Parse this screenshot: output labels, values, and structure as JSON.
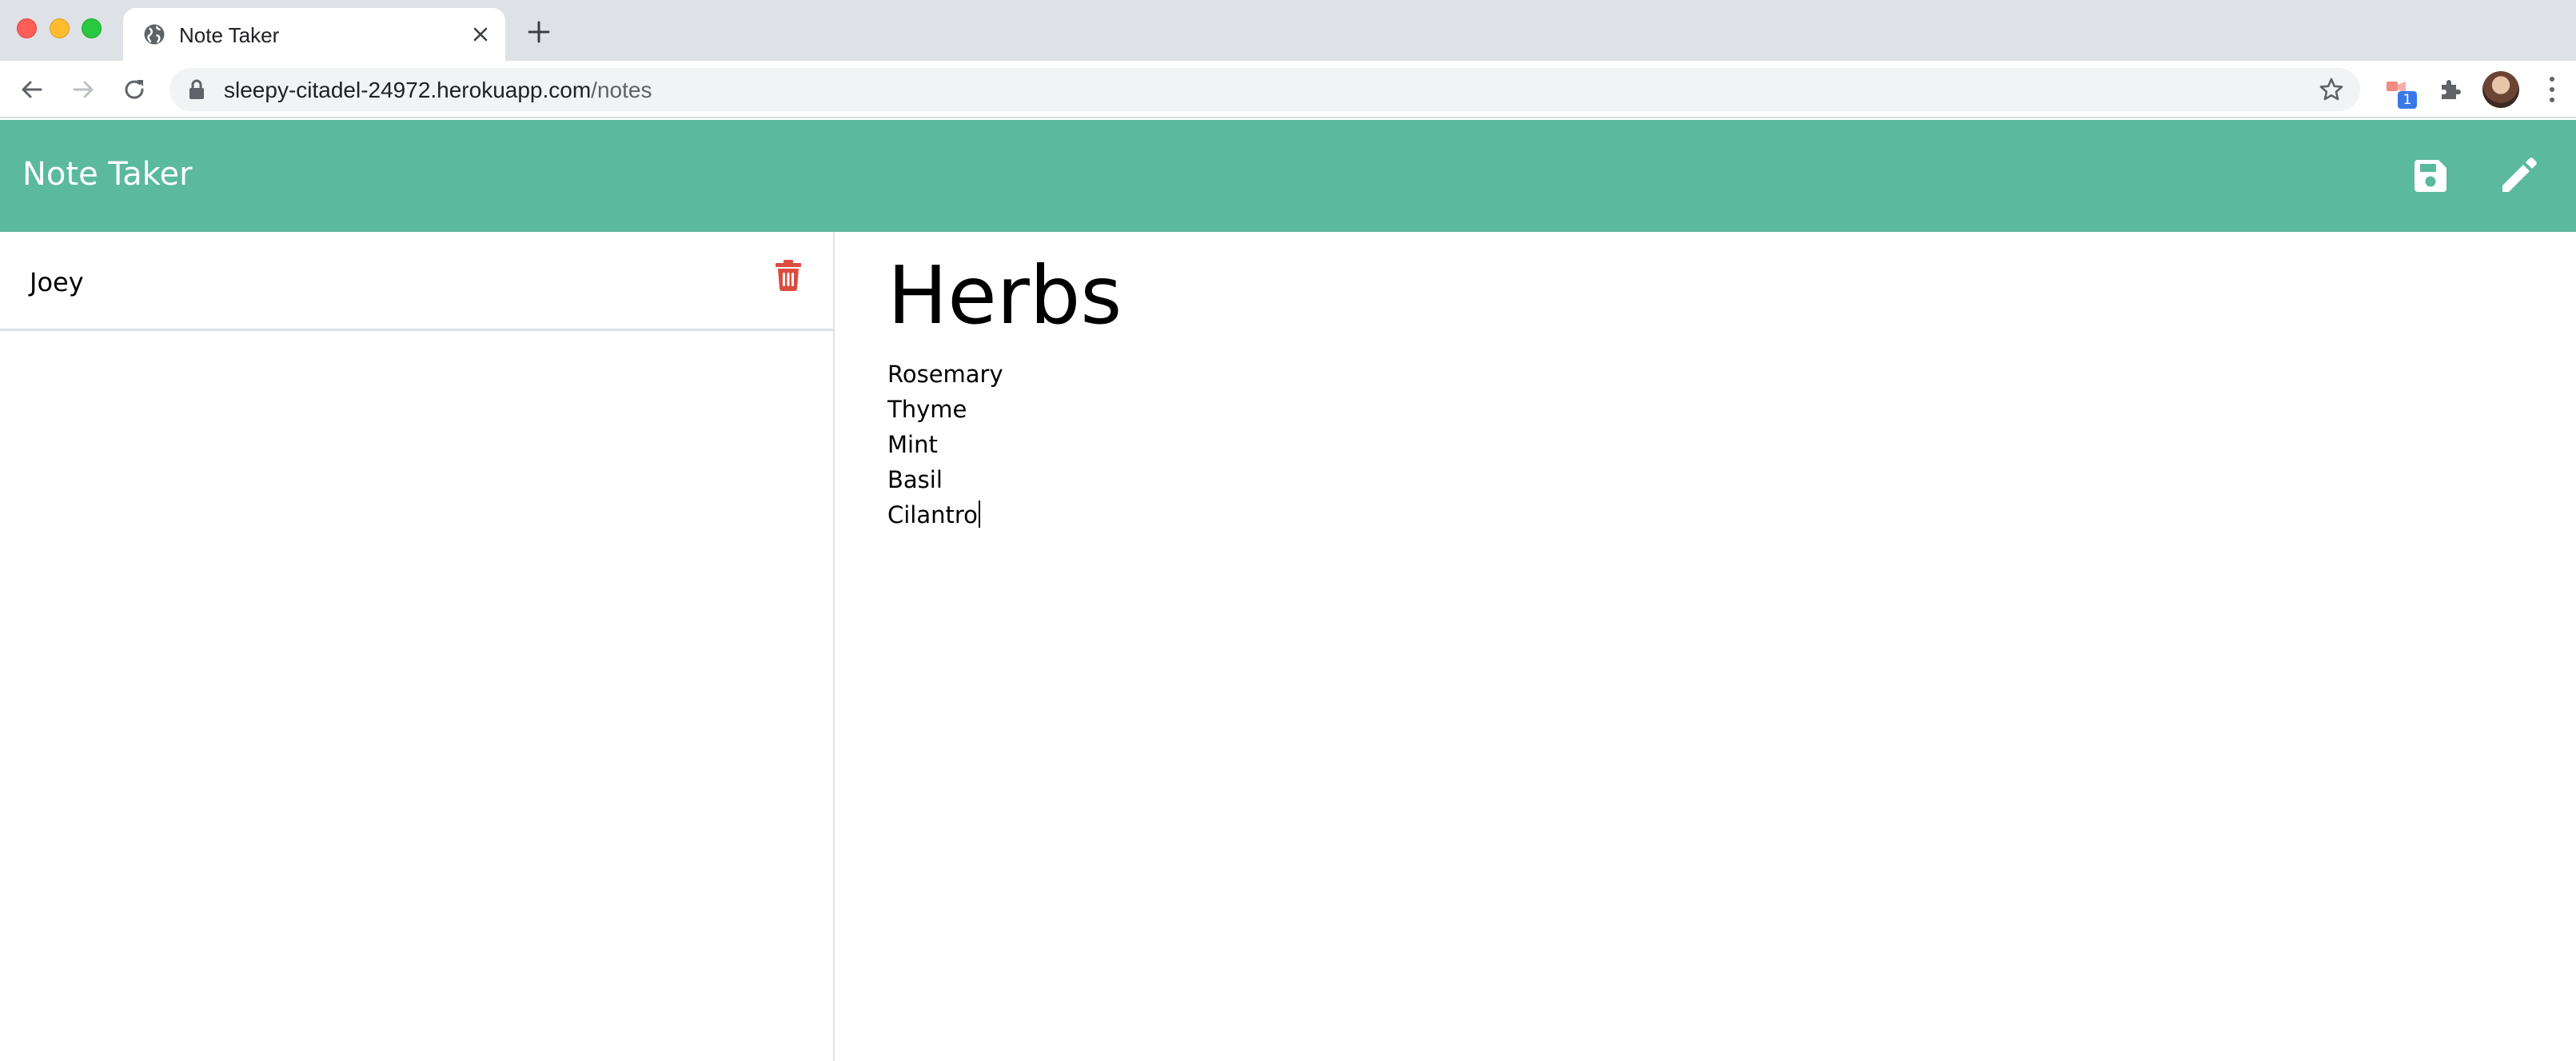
{
  "browser": {
    "tab_title": "Note Taker",
    "url_host": "sleepy-citadel-24972.herokuapp.com",
    "url_path": "/notes",
    "extension_badge": "1"
  },
  "app": {
    "brand": "Note Taker",
    "header_color": "#5bb99d",
    "delete_color": "#dc4c3f"
  },
  "sidebar": {
    "notes": [
      {
        "title": "Joey"
      }
    ]
  },
  "editor": {
    "title": "Herbs",
    "lines": [
      "Rosemary",
      "Thyme",
      "Mint",
      "Basil",
      "Cilantro"
    ]
  },
  "icons": {
    "tab": "globe-icon",
    "save": "save-icon",
    "new_note": "pencil-icon",
    "delete": "trash-icon"
  }
}
